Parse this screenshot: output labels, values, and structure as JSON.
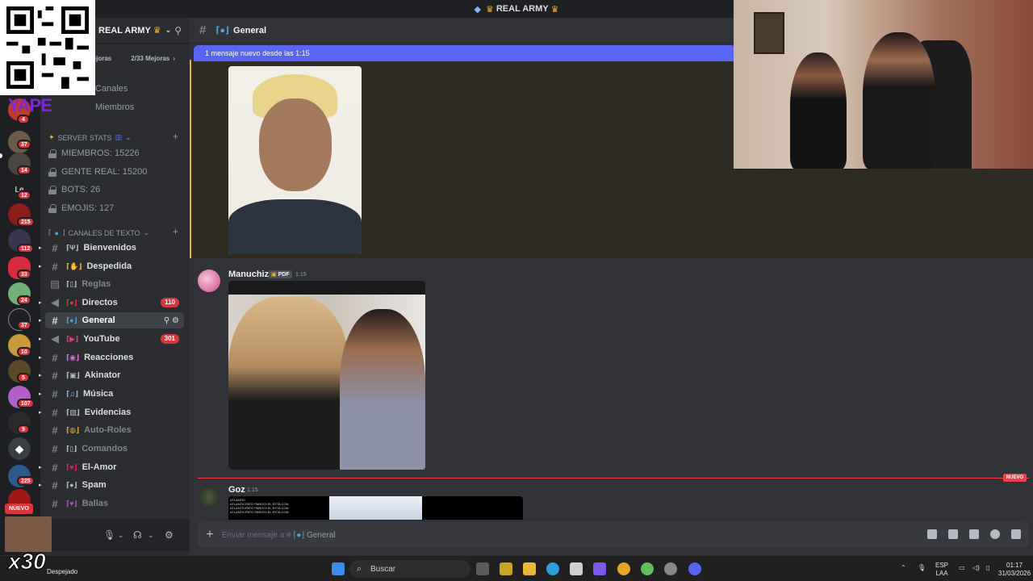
{
  "titlebar": {
    "title": "REAL ARMY"
  },
  "server": {
    "name": "REAL ARMY",
    "boost_left": "Mejoras",
    "boost_right": "2/33 Mejoras",
    "nav": [
      "Canales",
      "Miembros"
    ]
  },
  "rail_badges": [
    "4",
    "37",
    "14",
    "12",
    "215",
    "112",
    "33",
    "24",
    "37",
    "10",
    "5",
    "107",
    "9",
    "225"
  ],
  "rail_label_le": "Le",
  "categories": {
    "stats": "SERVER STATS",
    "text": "CANALES DE TEXTO"
  },
  "stats": [
    "MIEMBROS: 15226",
    "GENTE REAL: 15200",
    "BOTS: 26",
    "EMOJIS: 127"
  ],
  "channels": [
    {
      "name": "Bienvenidos",
      "badge": ""
    },
    {
      "name": "Despedida",
      "badge": ""
    },
    {
      "name": "Reglas",
      "badge": ""
    },
    {
      "name": "Directos",
      "badge": "110"
    },
    {
      "name": "General",
      "badge": ""
    },
    {
      "name": "YouTube",
      "badge": "301"
    },
    {
      "name": "Reacciones",
      "badge": ""
    },
    {
      "name": "Akinator",
      "badge": ""
    },
    {
      "name": "Música",
      "badge": ""
    },
    {
      "name": "Evidencias",
      "badge": ""
    },
    {
      "name": "Auto-Roles",
      "badge": ""
    },
    {
      "name": "Comandos",
      "badge": ""
    },
    {
      "name": "El-Amor",
      "badge": ""
    },
    {
      "name": "Spam",
      "badge": ""
    },
    {
      "name": "Ballas",
      "badge": ""
    }
  ],
  "chat": {
    "channel_name": "General",
    "new_messages_bar": "1 mensaje nuevo desde las 1:15",
    "messages": [
      {
        "author": "Manuchiz",
        "tag": "PDF",
        "time": "1:15"
      },
      {
        "author": "Goz",
        "time": "1:15"
      }
    ],
    "new_divider": "NUEVO",
    "composer_placeholder": "Enviar mensaje a #",
    "composer_channel": "General",
    "screenshot_text": [
      "ATLANTIC",
      "ATLANTICPATO PAROOI EL ESTA CON",
      "ATLANTICPATO PAROOI EL ESTA CON",
      "ATLANTICPATO PAROOI EL ESTA CON"
    ]
  },
  "overlays": {
    "yape": "YAPE",
    "nuevo": "NUEVO",
    "multiplier": "x30",
    "weather": "Despejado"
  },
  "taskbar": {
    "search": "Buscar",
    "lang_top": "ESP",
    "lang_bottom": "LAA",
    "time": "01:17",
    "date": "31/03/2026"
  }
}
